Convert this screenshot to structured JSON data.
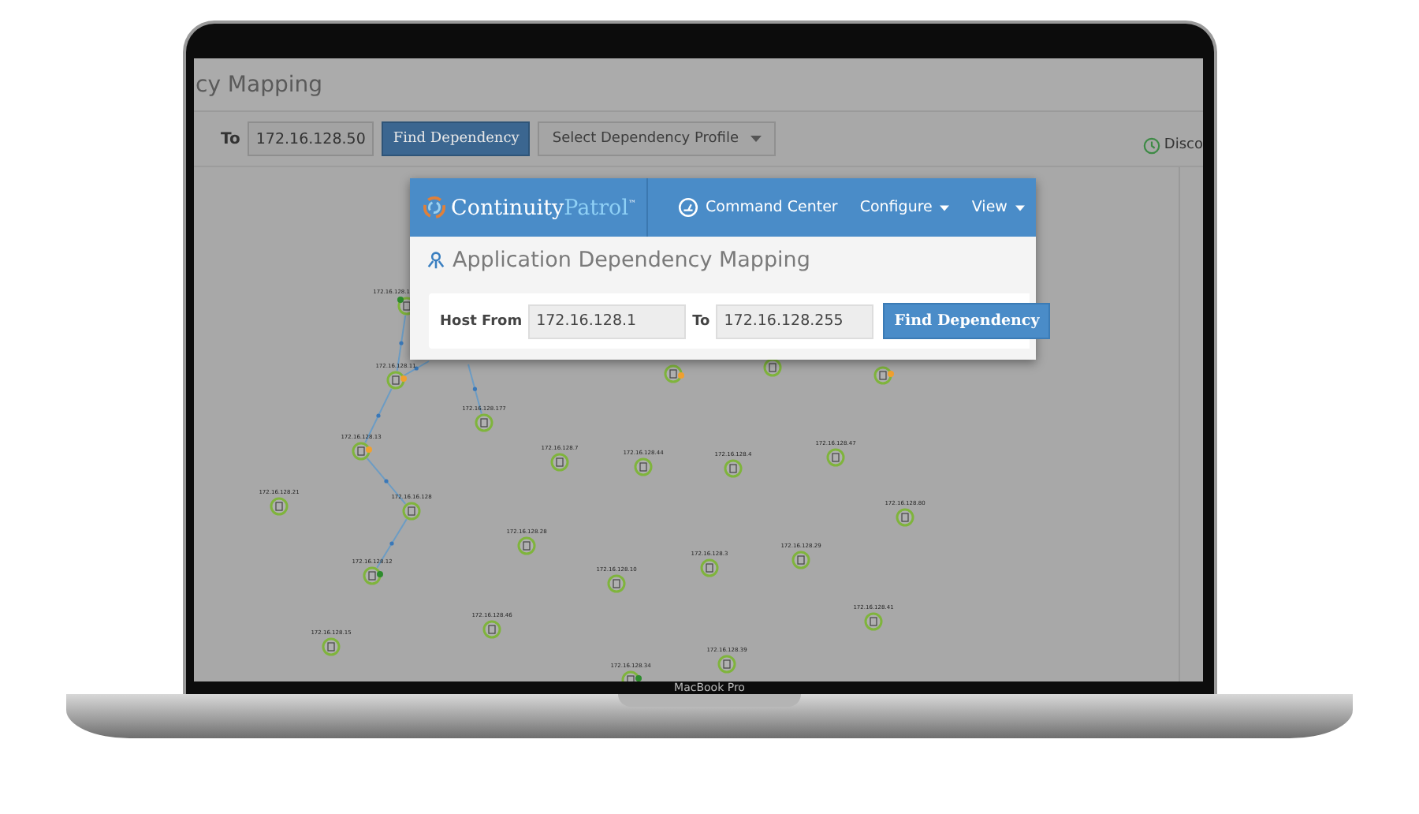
{
  "app": {
    "page_title": "cy Mapping",
    "toolbar": {
      "to_label": "To",
      "to_value": "172.16.128.50",
      "find_button": "Find Dependency",
      "profile_dropdown": "Select Dependency Profile",
      "discovery_label": "Disco"
    }
  },
  "graph": {
    "nodes": [
      {
        "label": "172.16.128.1",
        "color": "#2e8b2e"
      },
      {
        "label": "172.16.128.11",
        "color": "#f0a030"
      },
      {
        "label": "172.16.128.177"
      },
      {
        "label": "172.16.128.13",
        "color": "#f0a030"
      },
      {
        "label": "172.16.128.7"
      },
      {
        "label": "172.16.128.44"
      },
      {
        "label": "172.16.128.4"
      },
      {
        "label": "172.16.128.47"
      },
      {
        "label": "172.16.128.21"
      },
      {
        "label": "172.16.16.128"
      },
      {
        "label": "172.16.128.28"
      },
      {
        "label": "172.16.128.80"
      },
      {
        "label": "172.16.128.29"
      },
      {
        "label": "172.16.128.3"
      },
      {
        "label": "172.16.128.10"
      },
      {
        "label": "172.16.128.12",
        "color": "#2e8b2e"
      },
      {
        "label": "172.16.128.41"
      },
      {
        "label": "172.16.128.46"
      },
      {
        "label": "172.16.128.15"
      },
      {
        "label": "172.16.128.39"
      },
      {
        "label": "172.16.128.34",
        "color": "#2e8b2e"
      },
      {
        "color": "#f0a030"
      },
      {
        "color": "#f0a030"
      }
    ]
  },
  "popup": {
    "brand": {
      "name": "Continuity",
      "accent": "Patrol",
      "mark": "™"
    },
    "nav": [
      {
        "kind": "link",
        "label": "Command Center"
      },
      {
        "kind": "menu",
        "label": "Configure"
      },
      {
        "kind": "menu",
        "label": "View"
      }
    ],
    "title": "Application Dependency Mapping",
    "host_from_label": "Host From",
    "host_from_value": "172.16.128.1",
    "to_label": "To",
    "to_value": "172.16.128.255",
    "find_button": "Find Dependency"
  },
  "device": {
    "model": "MacBook Pro"
  }
}
